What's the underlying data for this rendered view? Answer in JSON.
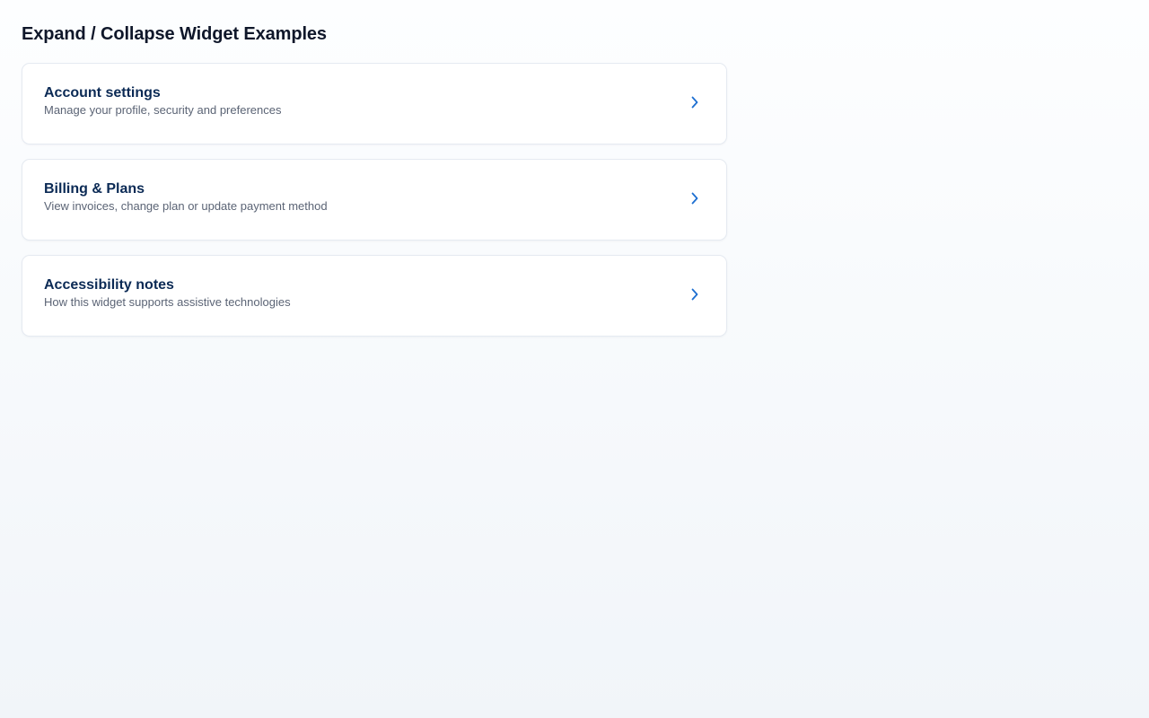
{
  "page": {
    "title": "Expand / Collapse Widget Examples"
  },
  "accordion": {
    "items": [
      {
        "title": "Account settings",
        "description": "Manage your profile, security and preferences",
        "icon": "chevron-right-icon",
        "expanded": false
      },
      {
        "title": "Billing & Plans",
        "description": "View invoices, change plan or update payment method",
        "icon": "chevron-right-icon",
        "expanded": false
      },
      {
        "title": "Accessibility notes",
        "description": "How this widget supports assistive technologies",
        "icon": "chevron-right-icon",
        "expanded": false
      }
    ]
  },
  "colors": {
    "title": "#0f172a",
    "item_title": "#0b2a55",
    "item_description": "#5b6475",
    "chevron": "#1d6fd1",
    "card_border": "#e5eaf1"
  }
}
